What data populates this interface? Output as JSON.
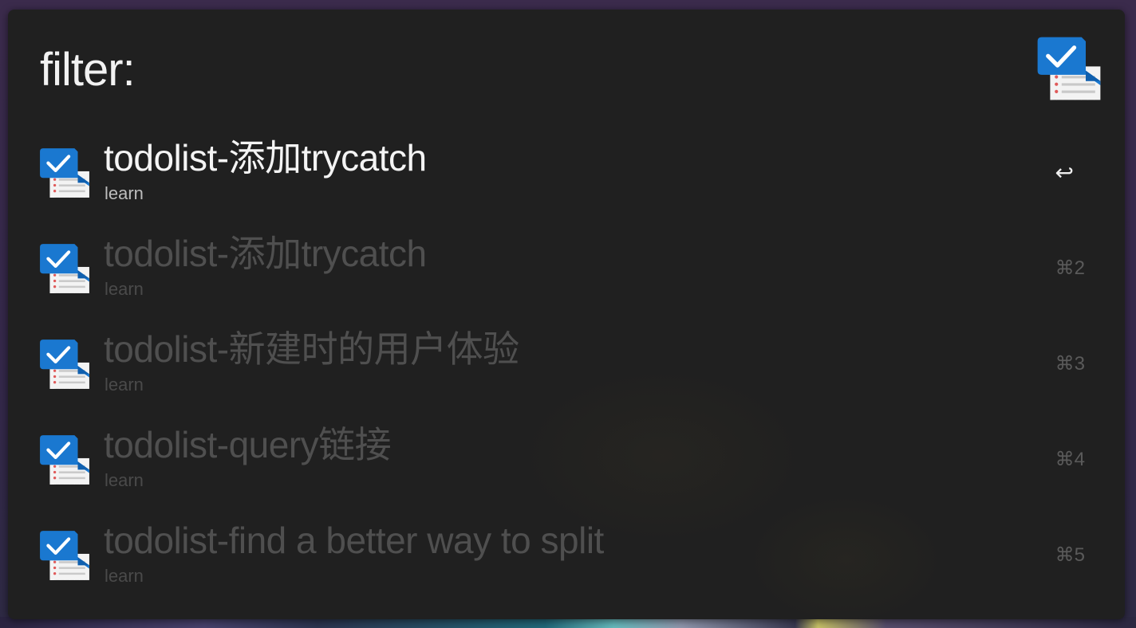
{
  "colors": {
    "panel_background": "#202020",
    "selected_text": "#f4f4f4",
    "dim_text": "#4f4f4f",
    "icon_blue": "#1a78d0"
  },
  "search": {
    "value": "filter:",
    "app_icon": "todo-checklist-icon"
  },
  "results": [
    {
      "title": "todolist-添加trycatch",
      "subtitle": "learn",
      "shortcut": "↩",
      "icon": "todo-checklist-icon",
      "selected": true
    },
    {
      "title": "todolist-添加trycatch",
      "subtitle": "learn",
      "shortcut": "⌘2",
      "icon": "todo-checklist-icon",
      "selected": false
    },
    {
      "title": "todolist-新建时的用户体验",
      "subtitle": "learn",
      "shortcut": "⌘3",
      "icon": "todo-checklist-icon",
      "selected": false
    },
    {
      "title": "todolist-query链接",
      "subtitle": "learn",
      "shortcut": "⌘4",
      "icon": "todo-checklist-icon",
      "selected": false
    },
    {
      "title": "todolist-find a better way to split",
      "subtitle": "learn",
      "shortcut": "⌘5",
      "icon": "todo-checklist-icon",
      "selected": false
    }
  ]
}
